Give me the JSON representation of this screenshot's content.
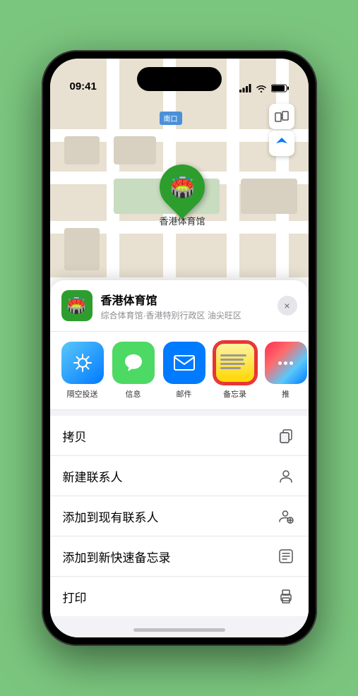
{
  "statusBar": {
    "time": "09:41",
    "locationIcon": "▶"
  },
  "mapLabel": {
    "text": "南口"
  },
  "locationPin": {
    "label": "香港体育馆"
  },
  "venueCard": {
    "name": "香港体育馆",
    "subtitle": "综合体育馆·香港特别行政区 油尖旺区",
    "closeLabel": "×"
  },
  "shareActions": [
    {
      "id": "airdrop",
      "label": "隔空投送",
      "type": "airdrop"
    },
    {
      "id": "messages",
      "label": "信息",
      "type": "messages"
    },
    {
      "id": "mail",
      "label": "邮件",
      "type": "mail"
    },
    {
      "id": "notes",
      "label": "备忘录",
      "type": "notes"
    },
    {
      "id": "more",
      "label": "推",
      "type": "more"
    }
  ],
  "actionItems": [
    {
      "id": "copy",
      "label": "拷贝",
      "iconUnicode": "⧉"
    },
    {
      "id": "new-contact",
      "label": "新建联系人",
      "iconUnicode": "👤"
    },
    {
      "id": "add-existing",
      "label": "添加到现有联系人",
      "iconUnicode": "👤"
    },
    {
      "id": "add-notes",
      "label": "添加到新快速备忘录",
      "iconUnicode": "📋"
    },
    {
      "id": "print",
      "label": "打印",
      "iconUnicode": "🖨"
    }
  ],
  "colors": {
    "background": "#7bc67e",
    "mapBg": "#e8e0d0",
    "pinGreen": "#2d9e2d",
    "accentBlue": "#007aff",
    "sheetBg": "#f2f2f7",
    "notesHighlight": "#e63535"
  }
}
